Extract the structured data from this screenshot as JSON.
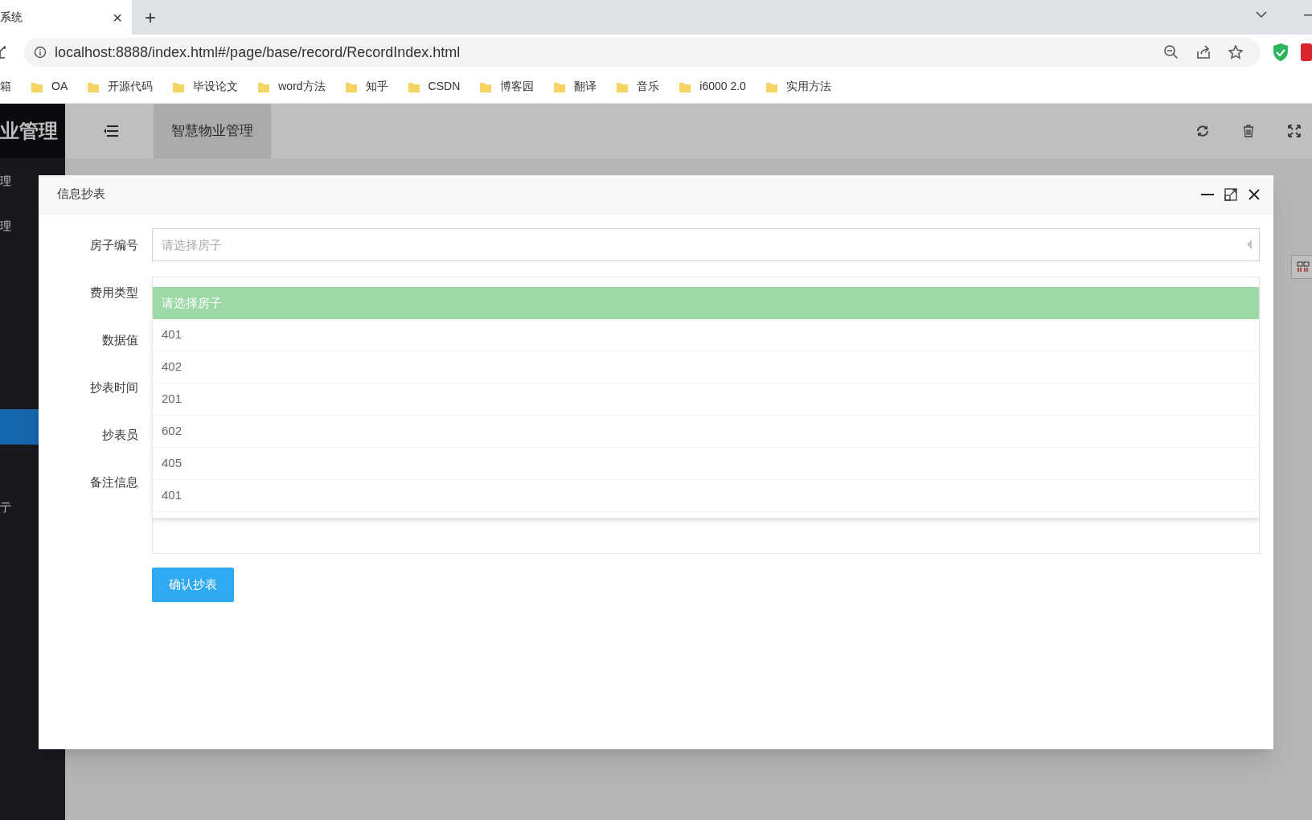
{
  "browser": {
    "tab": {
      "title": "系统",
      "close": "×"
    },
    "new_tab": "+",
    "address": "localhost:8888/index.html#/page/base/record/RecordIndex.html",
    "bookmarks": [
      {
        "label": "箱",
        "kind": "text"
      },
      {
        "label": "OA",
        "kind": "folder"
      },
      {
        "label": "开源代码",
        "kind": "folder"
      },
      {
        "label": "毕设论文",
        "kind": "folder"
      },
      {
        "label": "word方法",
        "kind": "folder"
      },
      {
        "label": "知乎",
        "kind": "folder"
      },
      {
        "label": "CSDN",
        "kind": "folder"
      },
      {
        "label": "博客园",
        "kind": "folder"
      },
      {
        "label": "翻译",
        "kind": "folder"
      },
      {
        "label": "音乐",
        "kind": "folder"
      },
      {
        "label": "i6000 2.0",
        "kind": "folder"
      },
      {
        "label": "实用方法",
        "kind": "folder"
      }
    ]
  },
  "app": {
    "logo": "业管理",
    "sidebar": [
      {
        "label": "理",
        "selected": false
      },
      {
        "label": "理",
        "selected": false
      },
      {
        "selected": true
      },
      {
        "label": "亍",
        "selected": false
      }
    ],
    "header_tab": {
      "label": "智慧物业管理",
      "selected": true
    }
  },
  "modal": {
    "title": "信息抄表",
    "fields": [
      {
        "label": "房子编号",
        "kind": "select",
        "placeholder": "请选择房子"
      },
      {
        "label": "费用类型",
        "kind": "hidden"
      },
      {
        "label": "数据值",
        "kind": "hidden"
      },
      {
        "label": "抄表时间",
        "kind": "hidden"
      },
      {
        "label": "抄表员",
        "kind": "hidden"
      },
      {
        "label": "备注信息",
        "kind": "textarea"
      }
    ],
    "dropdown": [
      {
        "label": "请选择房子",
        "selected": true
      },
      {
        "label": "401",
        "selected": false
      },
      {
        "label": "402",
        "selected": false
      },
      {
        "label": "201",
        "selected": false
      },
      {
        "label": "602",
        "selected": false
      },
      {
        "label": "405",
        "selected": false
      },
      {
        "label": "401",
        "selected": false
      }
    ],
    "submit": "确认抄表"
  }
}
